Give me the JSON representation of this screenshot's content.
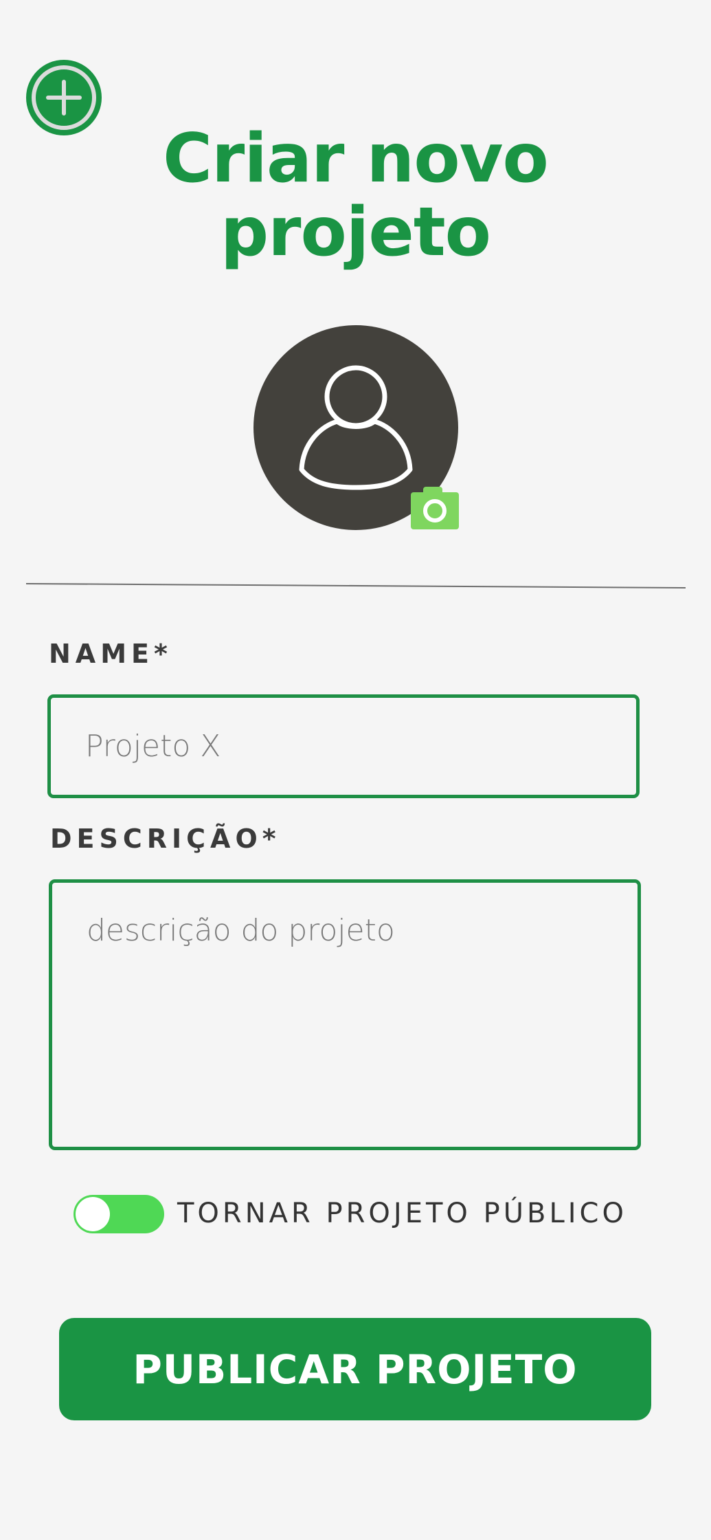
{
  "header": {
    "add_icon": "plus-circle-icon",
    "title_line1": "Criar novo",
    "title_line2": "projeto"
  },
  "avatar": {
    "icon": "user-icon",
    "camera_icon": "camera-icon"
  },
  "form": {
    "name_label": "NAME*",
    "name_placeholder": "Projeto X",
    "name_value": "",
    "description_label": "DESCRIÇÃO*",
    "description_placeholder": "descrição do projeto",
    "description_value": "",
    "public_toggle_label": "TORNAR PROJETO PÚBLICO",
    "public_toggle_on": true
  },
  "actions": {
    "publish_label": "PUBLICAR PROJETO"
  },
  "colors": {
    "primary": "#1a9444",
    "toggle_on": "#4fd855",
    "camera": "#7fd65f",
    "avatar_bg": "#43413c",
    "background": "#f5f5f5"
  }
}
